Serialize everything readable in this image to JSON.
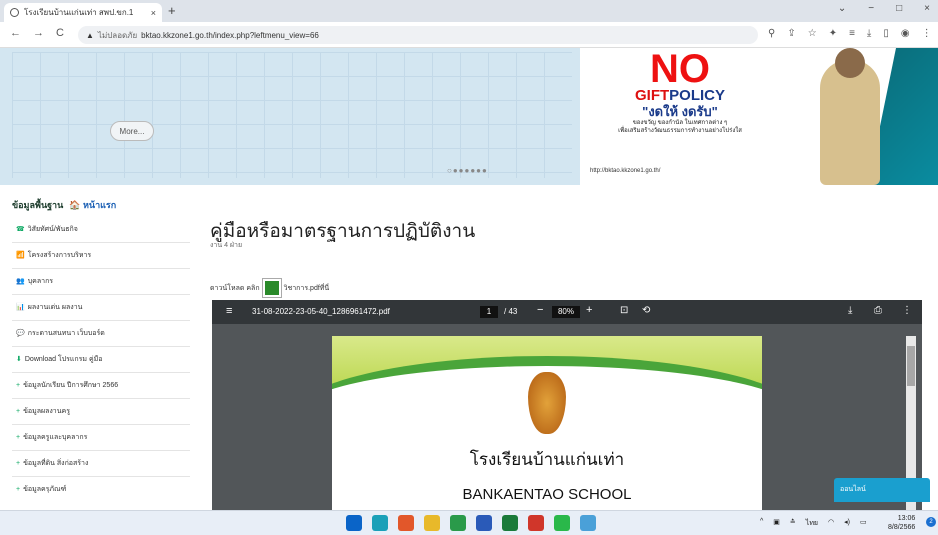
{
  "browser": {
    "tab_title": "โรงเรียนบ้านแก่นเท่า สพป.ขก.1",
    "tab_close": "×",
    "new_tab": "+",
    "url_warning": "▲",
    "url_not_secure": "ไม่ปลอดภัย",
    "url": "bktao.kkzone1.go.th/index.php?leftmenu_view=66",
    "window_controls": [
      "⌄",
      "−",
      "□",
      "×"
    ],
    "toolbar_icons": [
      "search-icon",
      "share-icon",
      "star-icon",
      "extension-icon",
      "menu-icon",
      "download-icon",
      "window-icon",
      "profile-icon",
      "more-icon"
    ]
  },
  "banner": {
    "more_label": "More...",
    "dots": "○●●●●●●",
    "gift_no": "NO",
    "gift_policy_a": "GIFT",
    "gift_policy_b": "POLICY",
    "gift_thai": "\"งดให้ งดรับ\"",
    "gift_line1": "ของขวัญ ของกำนัล ในเทศกาลต่าง ๆ",
    "gift_line2": "เพื่อเสริมสร้างวัฒนธรรมการทำงานอย่างโปร่งใส",
    "gift_url": "http://bktao.kkzone1.go.th/"
  },
  "sidebar": {
    "header_label": "ข้อมูลพื้นฐาน",
    "home_label": "หน้าแรก",
    "items": [
      {
        "icon": "☎",
        "label": "วิสัยทัศน์/พันธกิจ"
      },
      {
        "icon": "📶",
        "label": "โครงสร้างการบริหาร"
      },
      {
        "icon": "👥",
        "label": "บุคลากร"
      },
      {
        "icon": "📊",
        "label": "ผลงานเด่น ผลงาน"
      },
      {
        "icon": "💬",
        "label": "กระดานสนทนา เว็บบอร์ด"
      },
      {
        "icon": "⬇",
        "label": "Download โปรแกรม คู่มือ"
      },
      {
        "icon": "+",
        "label": "ข้อมูลนักเรียน ปีการศึกษา 2566"
      },
      {
        "icon": "+",
        "label": "ข้อมูลผลงานครู"
      },
      {
        "icon": "+",
        "label": "ข้อมูลครูและบุคลากร"
      },
      {
        "icon": "+",
        "label": "ข้อมูลที่ดิน สิ่งก่อสร้าง"
      },
      {
        "icon": "+",
        "label": "ข้อมูลครุภัณฑ์"
      }
    ]
  },
  "main": {
    "title": "คู่มือหรือมาตรฐานการปฏิบัติงาน",
    "subtitle": "งาน 4 ฝ่าย",
    "download_prefix": "ดาวน์โหลด คลิก",
    "download_suffix": "วิชาการ.pdfที่นี่"
  },
  "pdf": {
    "filename": "31-08-2022-23-05-40_1286961472.pdf",
    "page_current": "1",
    "page_total": "/ 43",
    "zoom": "80%",
    "school_th": "โรงเรียนบ้านแก่นเท่า",
    "school_en": "BANKAENTAO SCHOOL"
  },
  "online_label": "ออนไลน์",
  "taskbar": {
    "tray_lang": "ไทย",
    "time": "13:06",
    "date": "8/8/2566",
    "notif_count": "2",
    "apps": [
      {
        "name": "start",
        "color": "#0a64c8"
      },
      {
        "name": "edge",
        "color": "#1aa0b8"
      },
      {
        "name": "firefox",
        "color": "#e2572a"
      },
      {
        "name": "explorer",
        "color": "#e8b92a"
      },
      {
        "name": "chrome",
        "color": "#2a9a4a"
      },
      {
        "name": "word",
        "color": "#2a5ab8"
      },
      {
        "name": "excel",
        "color": "#1a7a3a"
      },
      {
        "name": "photos",
        "color": "#d0362a"
      },
      {
        "name": "line",
        "color": "#2ab84a"
      },
      {
        "name": "notepad",
        "color": "#4aa0d8"
      }
    ]
  }
}
